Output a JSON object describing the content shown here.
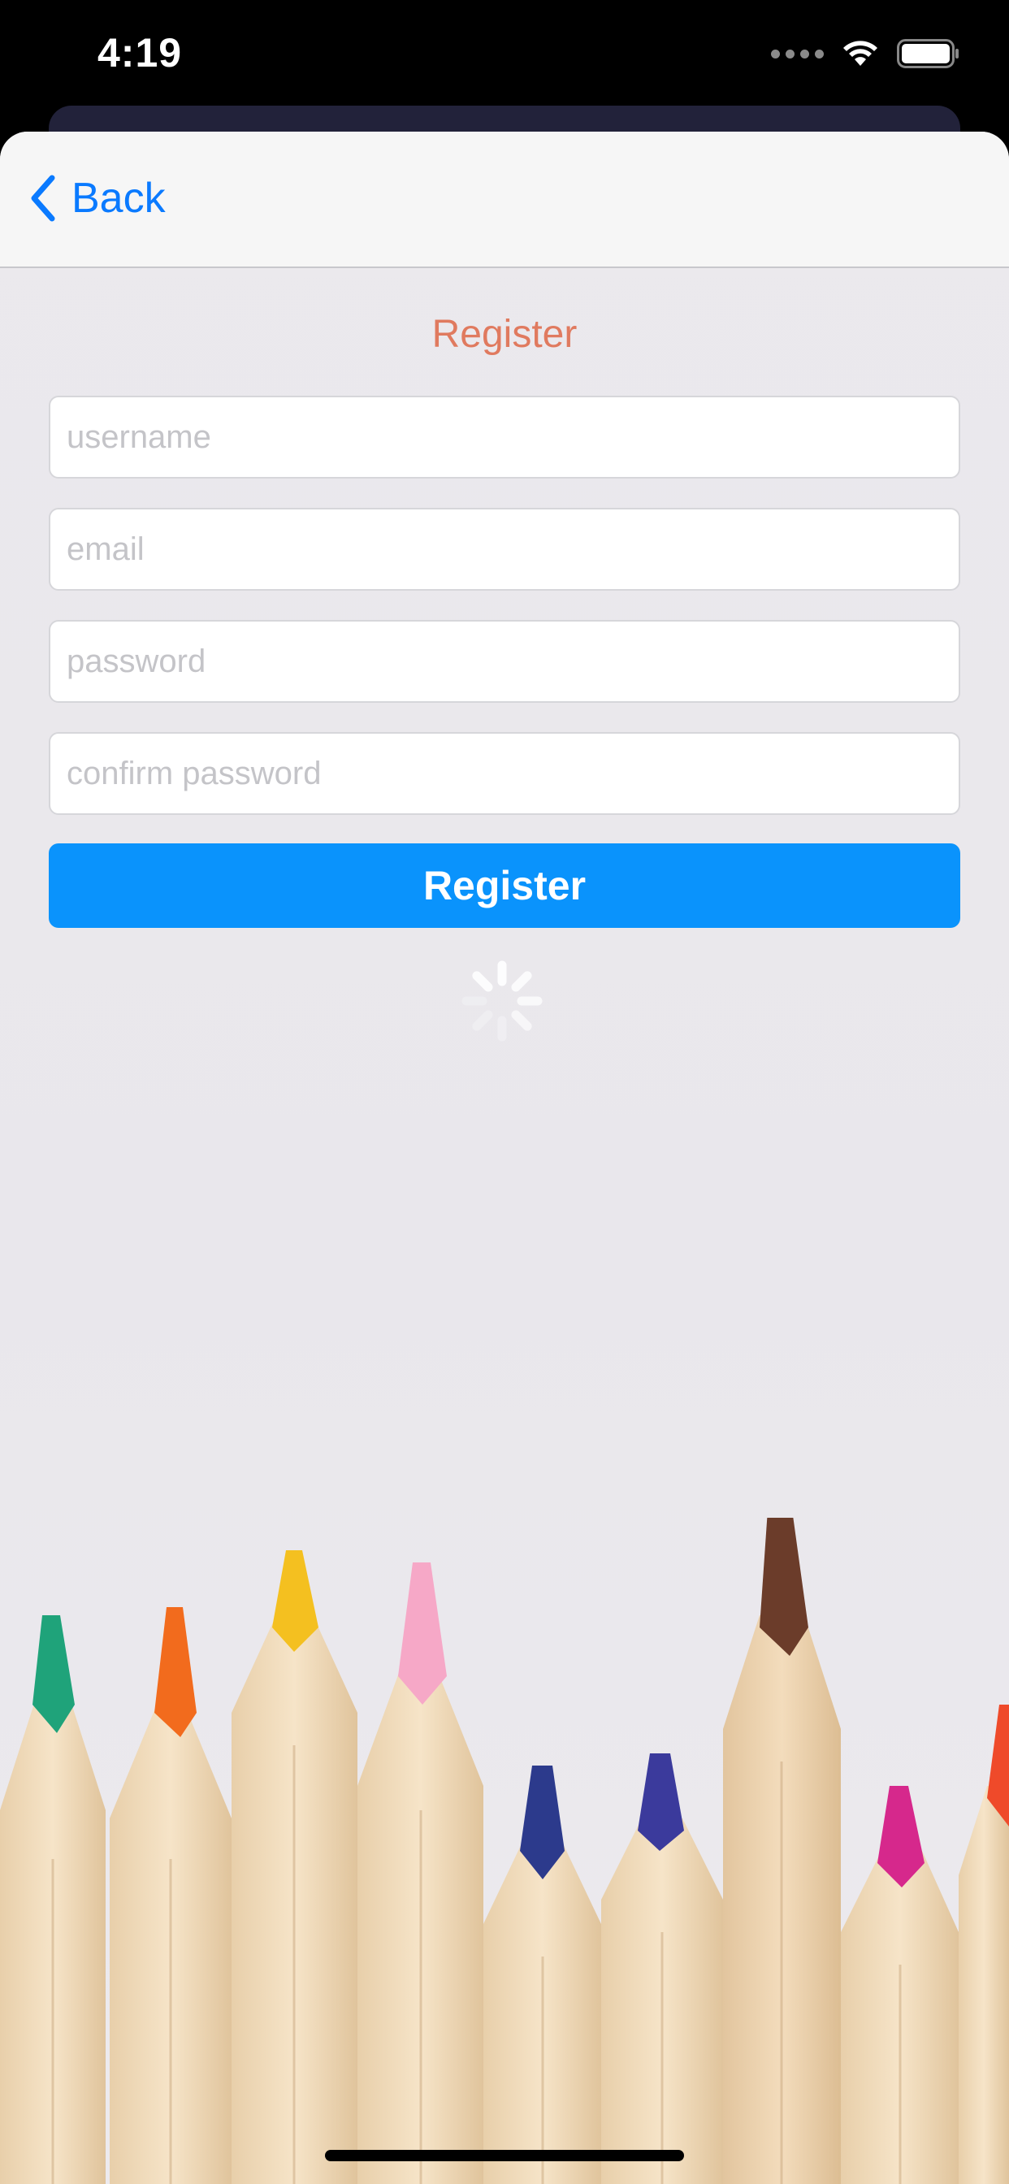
{
  "status_bar": {
    "time": "4:19"
  },
  "nav": {
    "back_label": "Back"
  },
  "page": {
    "title": "Register"
  },
  "form": {
    "username_placeholder": "username",
    "email_placeholder": "email",
    "password_placeholder": "password",
    "confirm_password_placeholder": "confirm password",
    "username_value": "",
    "email_value": "",
    "password_value": "",
    "confirm_password_value": "",
    "submit_label": "Register"
  },
  "colors": {
    "accent": "#0a7aff",
    "button": "#0a93fc",
    "title": "#e07a5f"
  },
  "icons": {
    "back": "chevron-left-icon",
    "spinner": "loading-spinner-icon",
    "wifi": "wifi-icon",
    "battery": "battery-icon"
  }
}
